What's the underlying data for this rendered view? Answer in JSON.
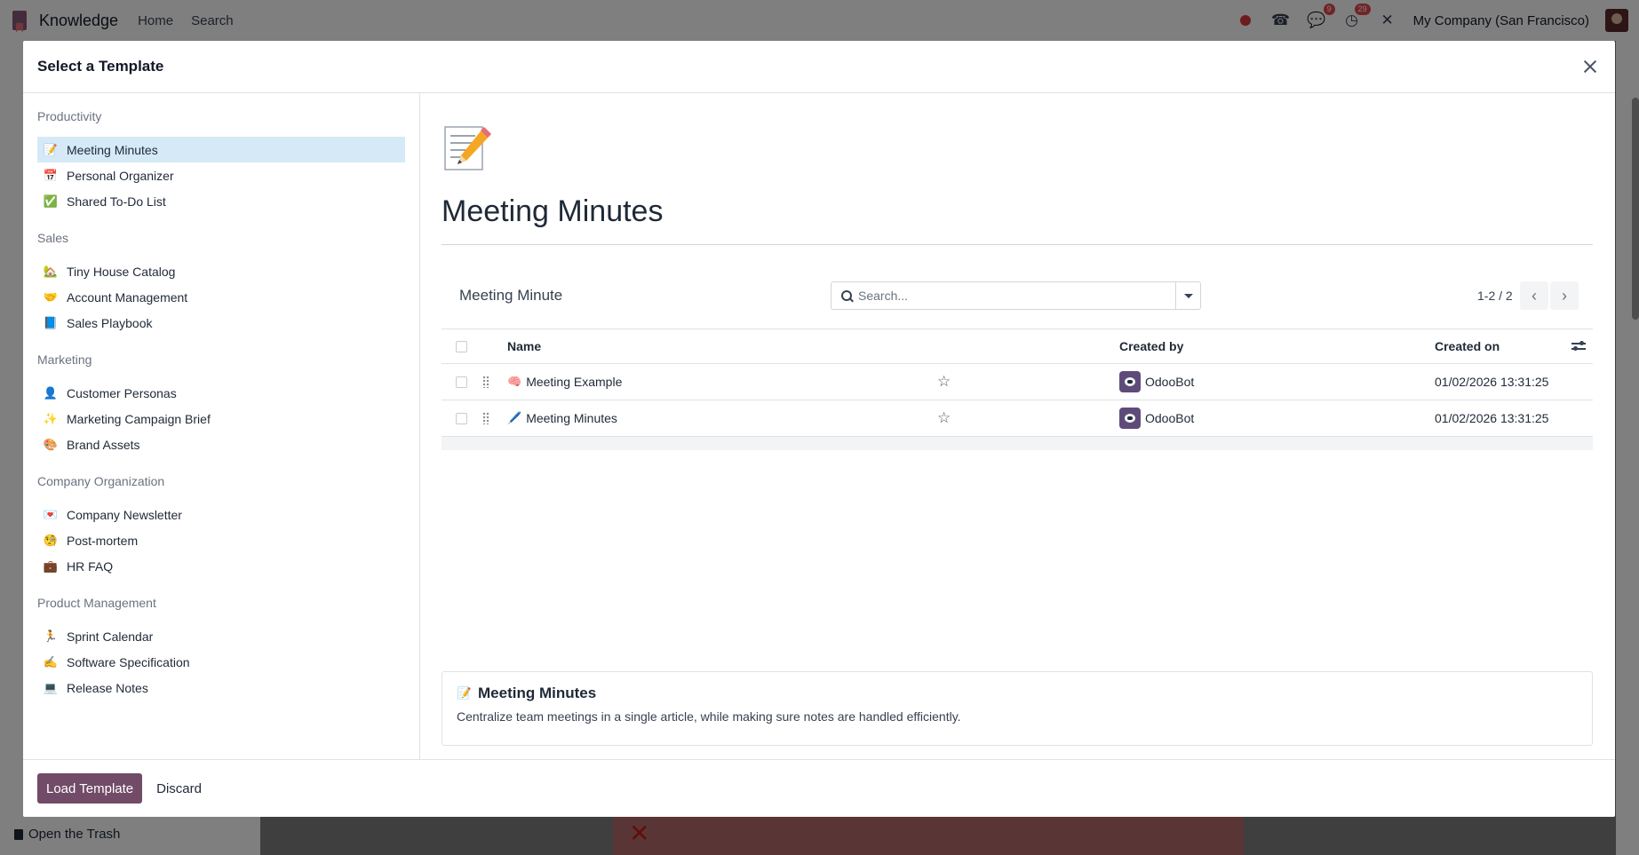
{
  "navbar": {
    "app_name": "Knowledge",
    "menu": [
      "Home",
      "Search"
    ],
    "messages_badge": "9",
    "activities_badge": "29",
    "company": "My Company (San Francisco)"
  },
  "background": {
    "trash_label": "Open the Trash"
  },
  "modal": {
    "title": "Select a Template",
    "groups": [
      {
        "title": "Productivity",
        "items": [
          {
            "emoji": "📝",
            "label": "Meeting Minutes",
            "active": true
          },
          {
            "emoji": "📅",
            "label": "Personal Organizer"
          },
          {
            "emoji": "✅",
            "label": "Shared To-Do List"
          }
        ]
      },
      {
        "title": "Sales",
        "items": [
          {
            "emoji": "🏡",
            "label": "Tiny House Catalog"
          },
          {
            "emoji": "🤝",
            "label": "Account Management"
          },
          {
            "emoji": "📘",
            "label": "Sales Playbook"
          }
        ]
      },
      {
        "title": "Marketing",
        "items": [
          {
            "emoji": "👤",
            "label": "Customer Personas"
          },
          {
            "emoji": "✨",
            "label": "Marketing Campaign Brief"
          },
          {
            "emoji": "🎨",
            "label": "Brand Assets"
          }
        ]
      },
      {
        "title": "Company Organization",
        "items": [
          {
            "emoji": "💌",
            "label": "Company Newsletter"
          },
          {
            "emoji": "🧐",
            "label": "Post-mortem"
          },
          {
            "emoji": "💼",
            "label": "HR FAQ"
          }
        ]
      },
      {
        "title": "Product Management",
        "items": [
          {
            "emoji": "🏃",
            "label": "Sprint Calendar"
          },
          {
            "emoji": "✍️",
            "label": "Software Specification"
          },
          {
            "emoji": "💻",
            "label": "Release Notes"
          }
        ]
      }
    ],
    "preview": {
      "emoji": "📝",
      "title": "Meeting Minutes",
      "list_name": "Meeting Minute",
      "search_placeholder": "Search...",
      "pager": "1-2 / 2",
      "columns": {
        "name": "Name",
        "created_by": "Created by",
        "created_on": "Created on"
      },
      "rows": [
        {
          "emoji": "🧠",
          "name": "Meeting Example",
          "created_by": "OdooBot",
          "created_on": "01/02/2026 13:31:25"
        },
        {
          "emoji": "🖊️",
          "name": "Meeting Minutes",
          "created_by": "OdooBot",
          "created_on": "01/02/2026 13:31:25"
        }
      ],
      "description_emoji": "📝",
      "description_title": "Meeting Minutes",
      "description_text": "Centralize team meetings in a single article, while making sure notes are handled efficiently."
    },
    "footer": {
      "load_label": "Load Template",
      "discard_label": "Discard"
    }
  }
}
